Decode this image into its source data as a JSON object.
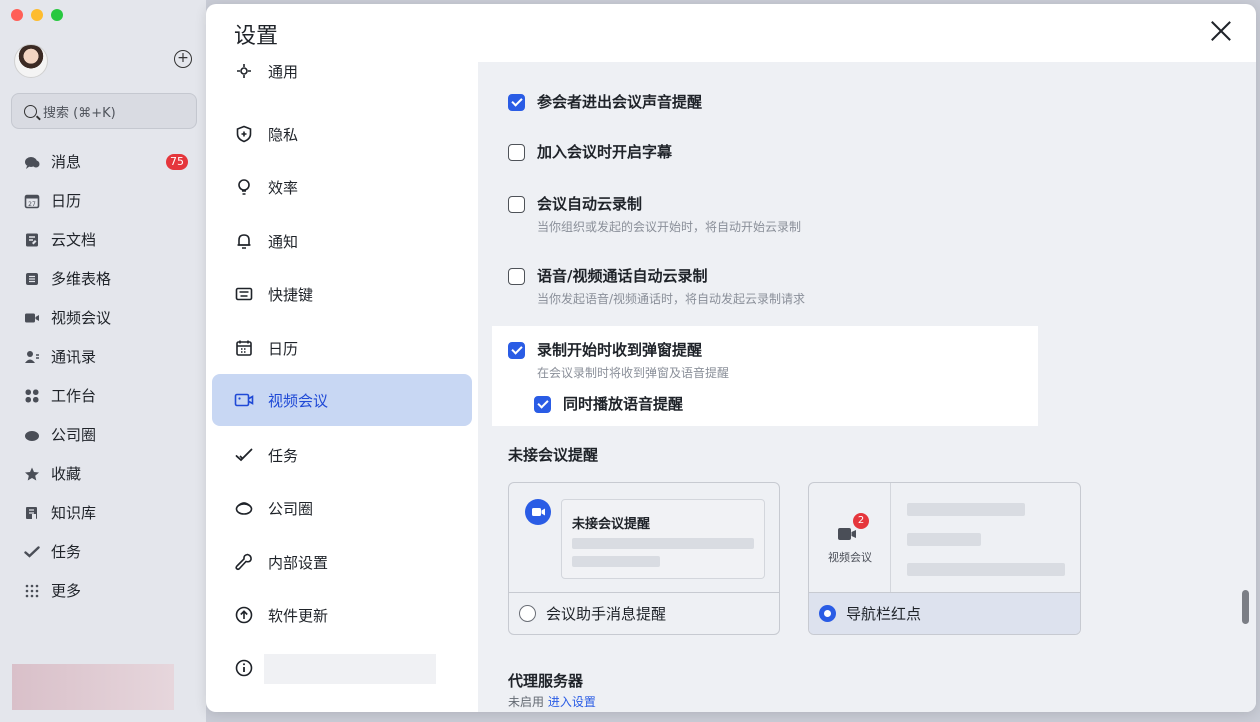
{
  "app": {
    "search_placeholder": "搜索 (⌘+K)",
    "nav": [
      {
        "label": "消息",
        "icon": "chat-bubble-icon",
        "badge": "75"
      },
      {
        "label": "日历",
        "icon": "calendar-icon",
        "badge": ""
      },
      {
        "label": "云文档",
        "icon": "document-icon",
        "badge": ""
      },
      {
        "label": "多维表格",
        "icon": "base-table-icon",
        "badge": ""
      },
      {
        "label": "视频会议",
        "icon": "video-camera-icon",
        "badge": ""
      },
      {
        "label": "通讯录",
        "icon": "contacts-icon",
        "badge": ""
      },
      {
        "label": "工作台",
        "icon": "workplace-grid-icon",
        "badge": ""
      },
      {
        "label": "公司圈",
        "icon": "moments-icon",
        "badge": ""
      },
      {
        "label": "收藏",
        "icon": "star-icon",
        "badge": ""
      },
      {
        "label": "知识库",
        "icon": "wiki-icon",
        "badge": ""
      },
      {
        "label": "任务",
        "icon": "task-check-icon",
        "badge": ""
      },
      {
        "label": "更多",
        "icon": "more-dots-icon",
        "badge": ""
      }
    ]
  },
  "settings": {
    "title": "设置",
    "nav": [
      {
        "label": "通用",
        "icon": "general-icon"
      },
      {
        "label": "隐私",
        "icon": "shield-icon"
      },
      {
        "label": "效率",
        "icon": "lightbulb-icon"
      },
      {
        "label": "通知",
        "icon": "bell-icon"
      },
      {
        "label": "快捷键",
        "icon": "keyboard-icon"
      },
      {
        "label": "日历",
        "icon": "calendar-icon"
      },
      {
        "label": "视频会议",
        "icon": "video-camera-icon"
      },
      {
        "label": "任务",
        "icon": "task-check-icon"
      },
      {
        "label": "公司圈",
        "icon": "moments-icon"
      },
      {
        "label": "内部设置",
        "icon": "wrench-icon"
      },
      {
        "label": "软件更新",
        "icon": "update-arrow-icon"
      },
      {
        "label": "",
        "icon": "info-icon"
      }
    ],
    "active_index": 6,
    "options": [
      {
        "label": "参会者进出会议声音提醒",
        "desc": "",
        "checked": true
      },
      {
        "label": "加入会议时开启字幕",
        "desc": "",
        "checked": false
      },
      {
        "label": "会议自动云录制",
        "desc": "当你组织或发起的会议开始时，将自动开始云录制",
        "checked": false
      },
      {
        "label": "语音/视频通话自动云录制",
        "desc": "当你发起语音/视频通话时，将自动发起云录制请求",
        "checked": false
      },
      {
        "label": "录制开始时收到弹窗提醒",
        "desc": "在会议录制时将收到弹窗及语音提醒",
        "checked": true
      },
      {
        "label": "同时播放语音提醒",
        "desc": "",
        "checked": true
      }
    ],
    "missed": {
      "title": "未接会议提醒",
      "card1": {
        "preview_title": "未接会议提醒",
        "option": "会议助手消息提醒",
        "selected": false
      },
      "card2": {
        "icon_label": "视频会议",
        "badge": "2",
        "option": "导航栏红点",
        "selected": true
      }
    },
    "proxy": {
      "title": "代理服务器",
      "status": "未启用",
      "link": "进入设置"
    }
  }
}
